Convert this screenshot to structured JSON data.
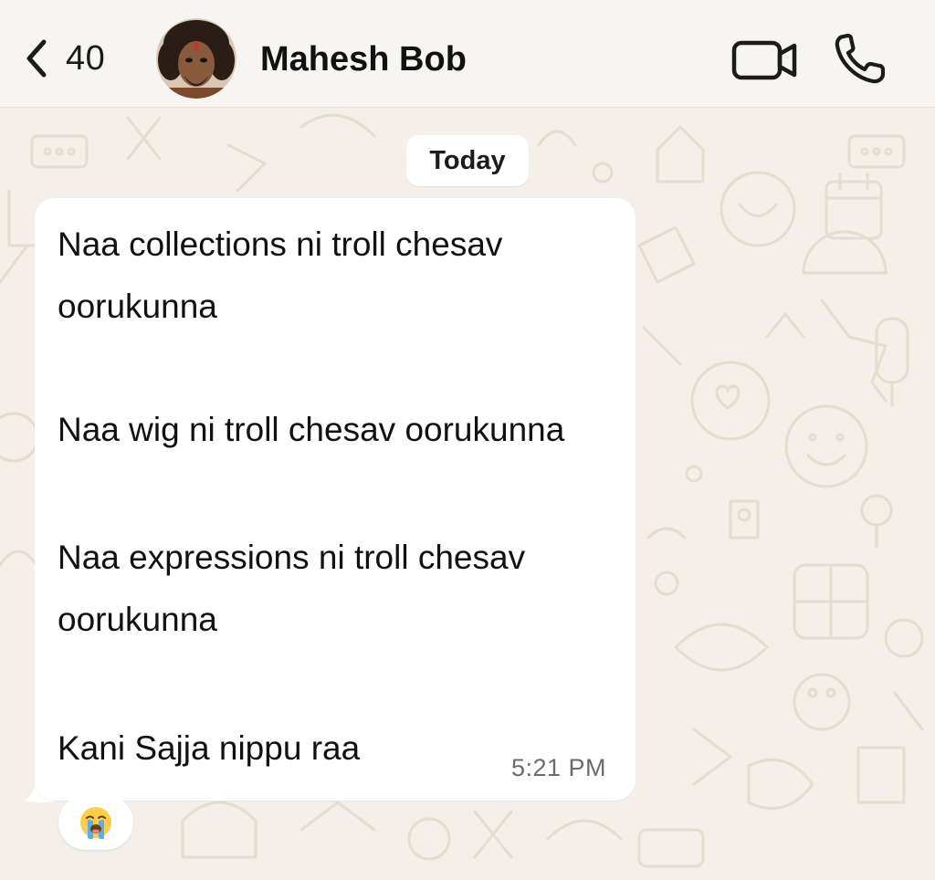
{
  "header": {
    "back_count": "40",
    "contact_name": "Mahesh Bob",
    "icons": [
      "chevron-left-icon",
      "video-call-icon",
      "phone-icon"
    ]
  },
  "chat": {
    "date_label": "Today",
    "message": {
      "lines": [
        "Naa collections ni troll chesav oorukunna",
        "Naa wig ni troll chesav oorukunna",
        "Naa expressions ni troll chesav oorukunna",
        "Kani Sajja nippu raa"
      ],
      "time": "5:21 PM"
    },
    "reaction": {
      "emoji": "loudly-crying-face-icon"
    }
  },
  "colors": {
    "wallpaper": "#f4f0e9",
    "header": "#f6f5f2",
    "bubble": "#ffffff",
    "doodle": "#e8dfd2",
    "text": "#111111",
    "timestamp": "#6b6b6b"
  }
}
